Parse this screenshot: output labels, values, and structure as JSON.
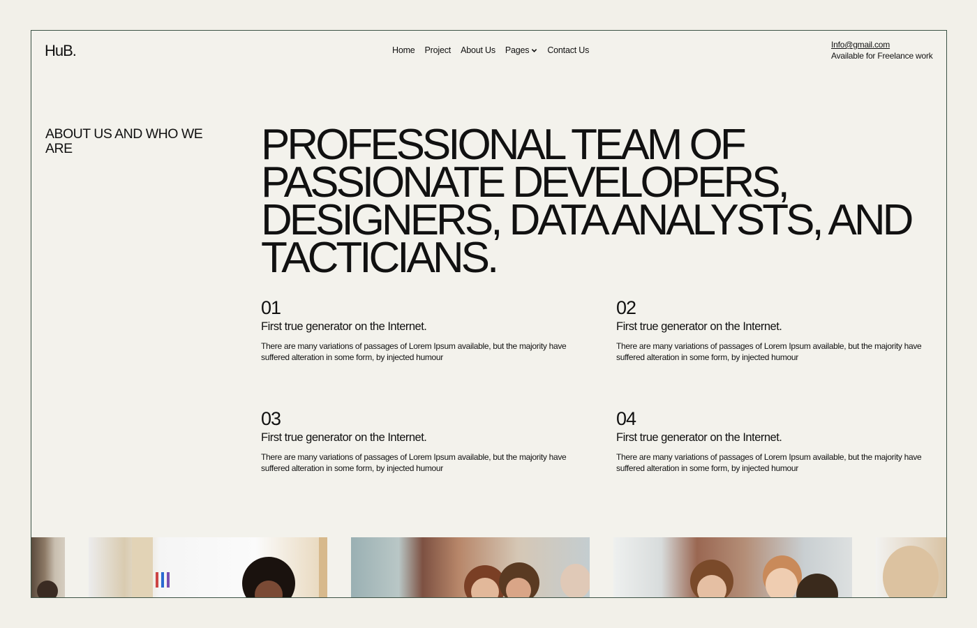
{
  "header": {
    "logo": "HuB.",
    "nav": [
      {
        "label": "Home"
      },
      {
        "label": "Project"
      },
      {
        "label": "About Us"
      },
      {
        "label": "Pages",
        "icon": "chevron-down-icon"
      },
      {
        "label": "Contact Us"
      }
    ],
    "email": "Info@gmail.com",
    "availability": "Available for Freelance work"
  },
  "about": {
    "side_title": "ABOUT US AND WHO WE ARE",
    "headline": "PROFESSIONAL TEAM OF PASSIONATE DEVELOPERS, DESIGNERS, DATA ANALYSTS, AND TACTICIANS."
  },
  "features": [
    {
      "num": "01",
      "title": "First true generator on the Internet.",
      "desc": "There are many variations of passages of Lorem Ipsum available, but the majority have suffered alteration in some form, by injected humour"
    },
    {
      "num": "02",
      "title": "First true generator on the Internet.",
      "desc": "There are many variations of passages of Lorem Ipsum available, but the majority have suffered alteration in some form, by injected humour"
    },
    {
      "num": "03",
      "title": "First true generator on the Internet.",
      "desc": "There are many variations of passages of Lorem Ipsum available, but the majority have suffered alteration in some form, by injected humour"
    },
    {
      "num": "04",
      "title": "First true generator on the Internet.",
      "desc": "There are many variations of passages of Lorem Ipsum available, but the majority have suffered alteration in some form, by injected humour"
    }
  ]
}
